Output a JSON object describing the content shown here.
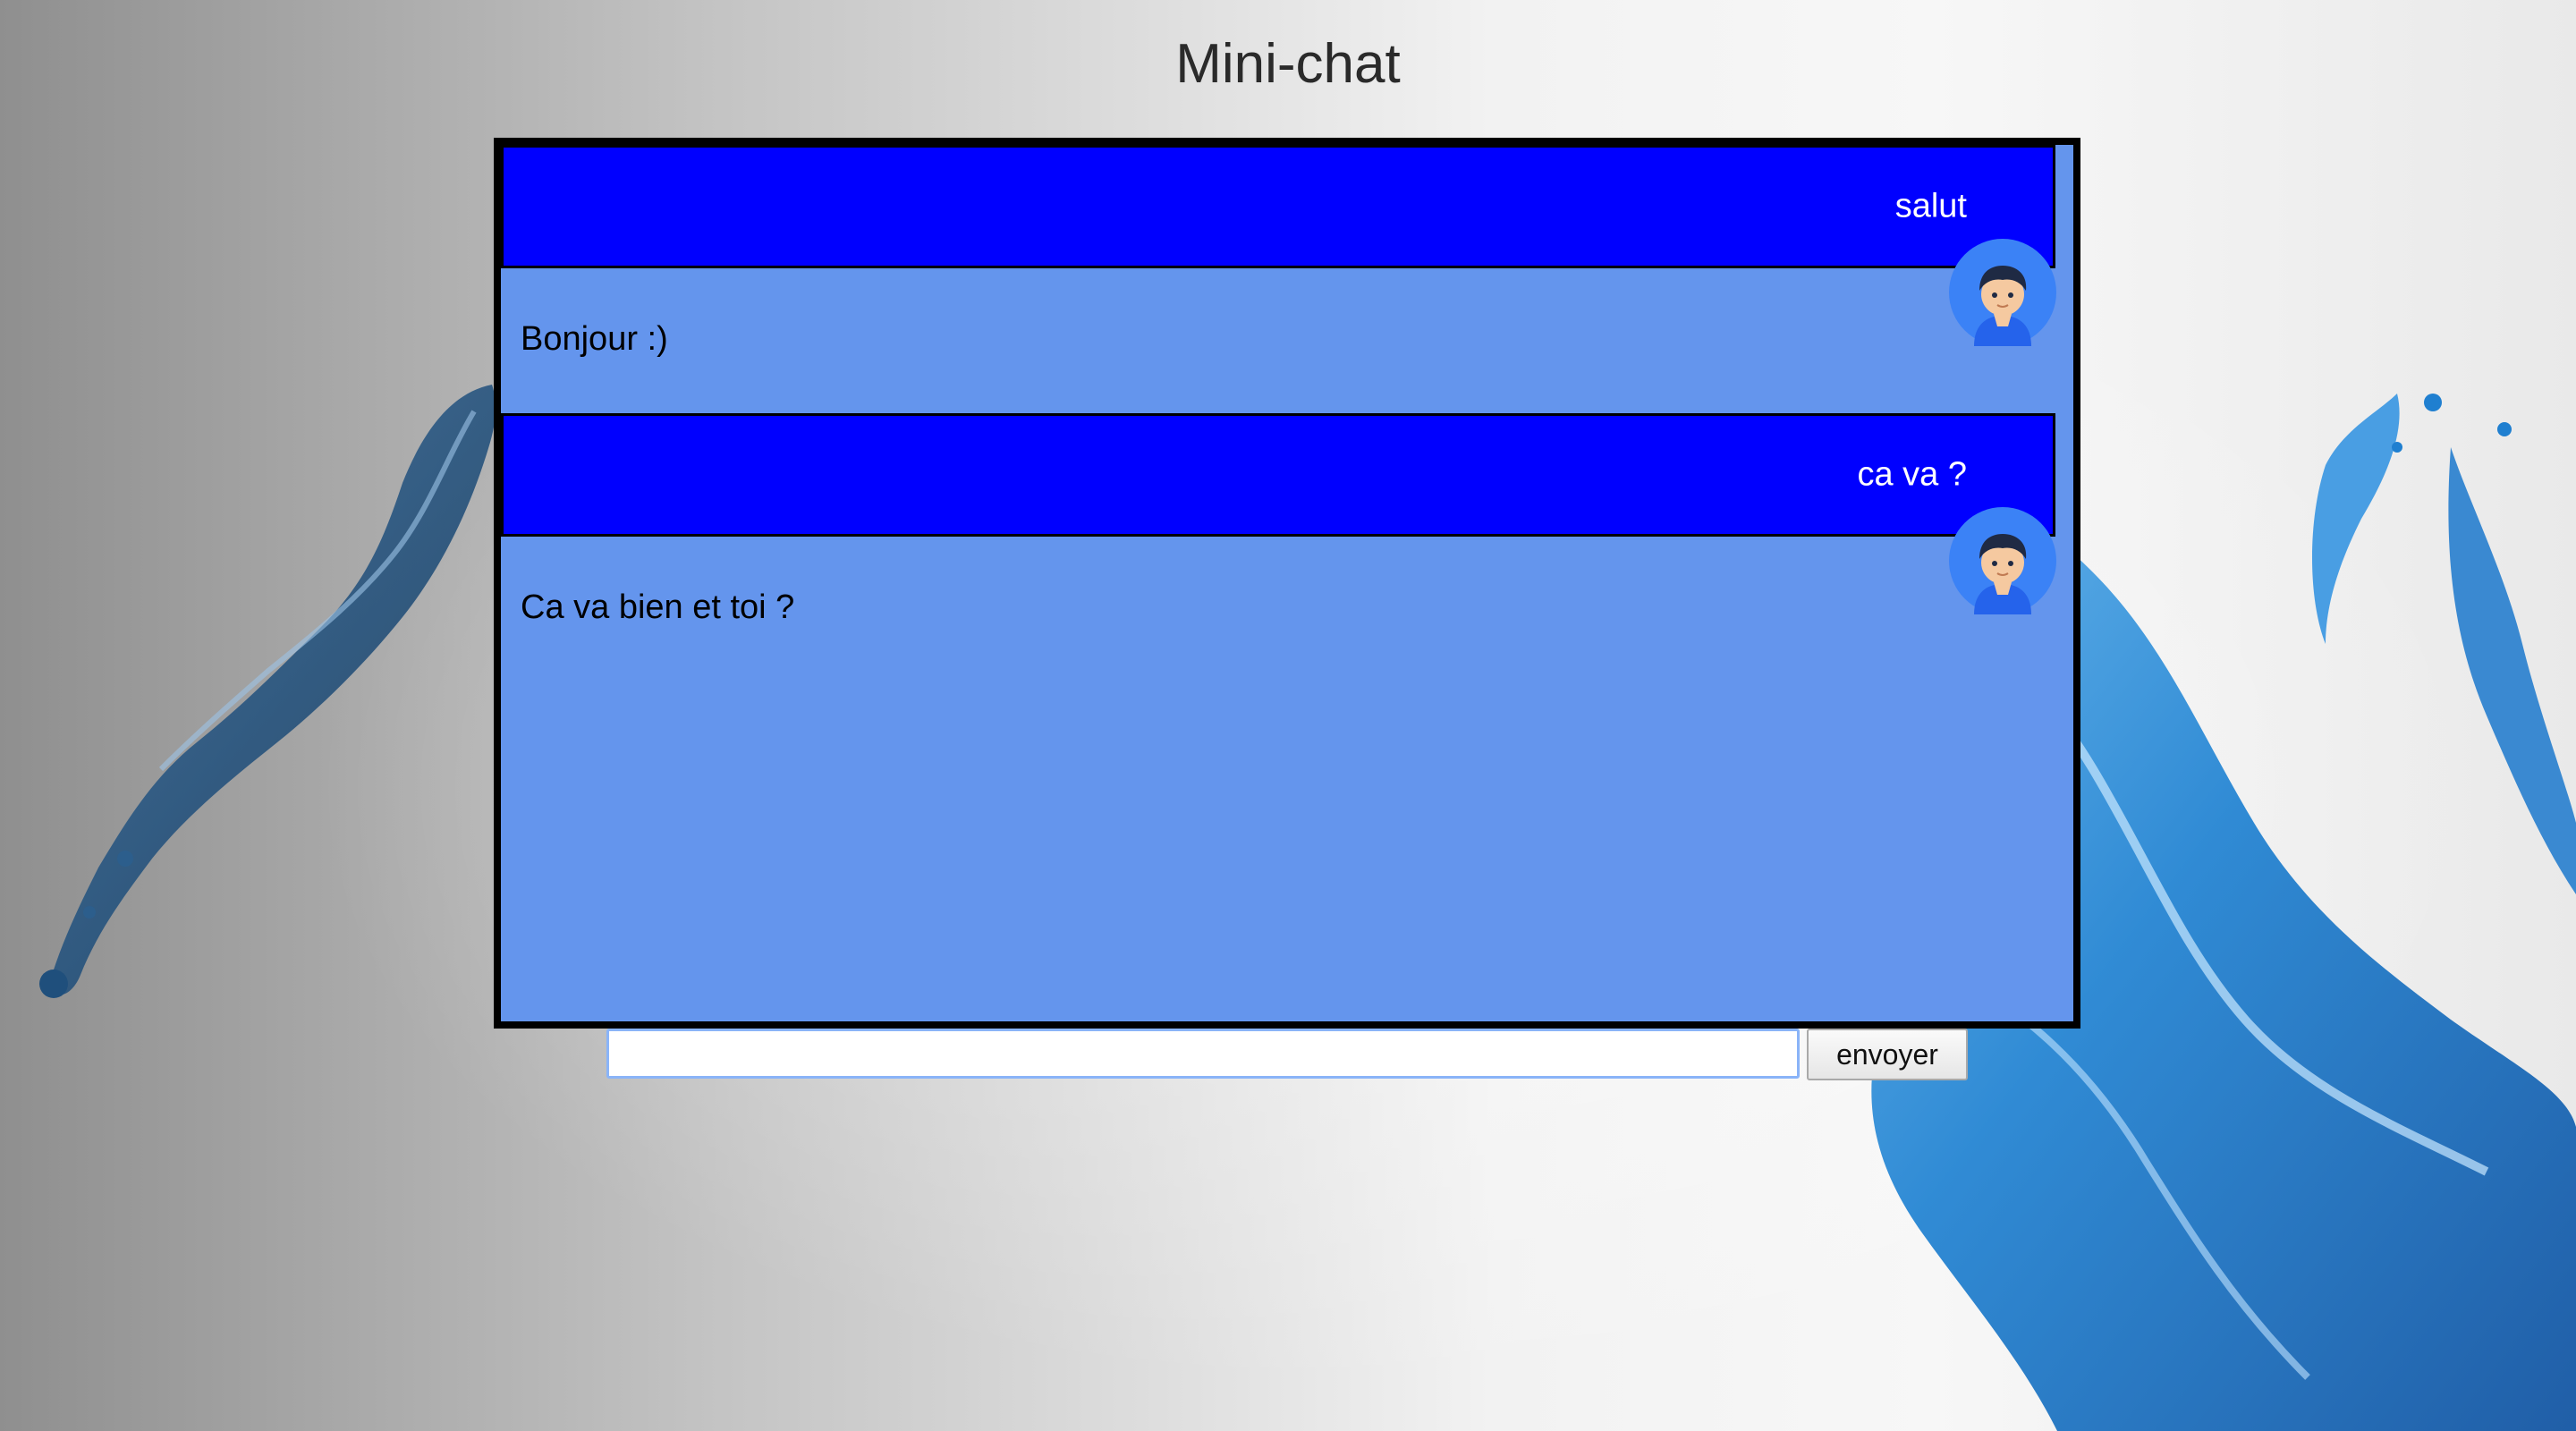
{
  "page": {
    "title": "Mini-chat"
  },
  "chat": {
    "messages": [
      {
        "kind": "sent",
        "text": "salut",
        "avatar_icon": "user-avatar-icon"
      },
      {
        "kind": "received",
        "text": "Bonjour :)"
      },
      {
        "kind": "sent",
        "text": "ca va ?",
        "avatar_icon": "user-avatar-icon"
      },
      {
        "kind": "received",
        "text": "Ca va bien et toi ?"
      }
    ]
  },
  "composer": {
    "input_value": "",
    "send_label": "envoyer"
  },
  "colors": {
    "sent_bubble": "#0000ff",
    "received_bubble": "#6495ed",
    "chat_border": "#000000",
    "avatar_bg": "#3b82f6",
    "input_border": "#8ab4f8"
  }
}
